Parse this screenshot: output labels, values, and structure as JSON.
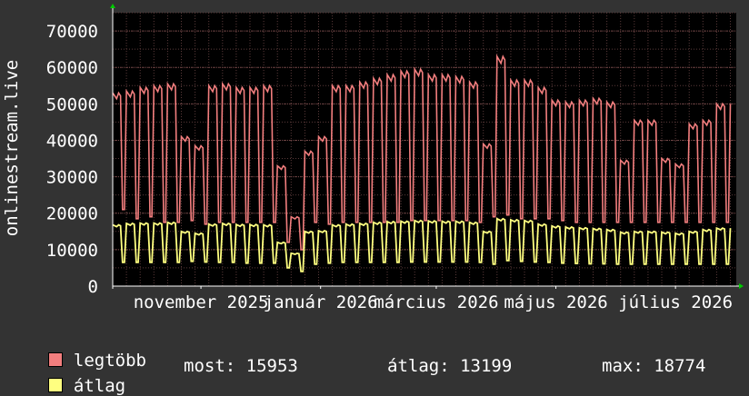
{
  "chart_data": {
    "type": "line",
    "ylabel": "onlinestream.live",
    "ylim": [
      0,
      75000
    ],
    "yticks": [
      0,
      10000,
      20000,
      30000,
      40000,
      50000,
      60000,
      70000
    ],
    "ytick_labels": [
      "0",
      "10000",
      "20000",
      "30000",
      "40000",
      "50000",
      "60000",
      "70000"
    ],
    "xlim": [
      "2025-10-01",
      "2026-08-15"
    ],
    "xticks": [
      {
        "date": "2025-11-15",
        "label": "november 2025"
      },
      {
        "date": "2026-01-15",
        "label": "január 2026"
      },
      {
        "date": "2026-03-15",
        "label": "március 2026"
      },
      {
        "date": "2026-05-15",
        "label": "május 2026"
      },
      {
        "date": "2026-07-15",
        "label": "július 2026"
      }
    ],
    "grid": true,
    "series": [
      {
        "name": "legtöbb",
        "color": "#f27e7e",
        "weekly": [
          [
            "2025-10-01",
            53000,
            21000
          ],
          [
            "2025-10-08",
            53500,
            18500
          ],
          [
            "2025-10-15",
            54500,
            19000
          ],
          [
            "2025-10-22",
            55000,
            17500
          ],
          [
            "2025-10-29",
            55500,
            17500
          ],
          [
            "2025-11-05",
            41000,
            18000
          ],
          [
            "2025-11-12",
            38500,
            17000
          ],
          [
            "2025-11-19",
            55000,
            17500
          ],
          [
            "2025-11-26",
            55500,
            17500
          ],
          [
            "2025-12-03",
            54500,
            17500
          ],
          [
            "2025-12-10",
            54500,
            17500
          ],
          [
            "2025-12-17",
            55000,
            17500
          ],
          [
            "2025-12-24",
            33000,
            12000
          ],
          [
            "2025-12-31",
            19000,
            10000
          ],
          [
            "2026-01-07",
            37000,
            17500
          ],
          [
            "2026-01-14",
            41000,
            17000
          ],
          [
            "2026-01-21",
            55000,
            17500
          ],
          [
            "2026-01-28",
            55000,
            17500
          ],
          [
            "2026-02-04",
            56000,
            17500
          ],
          [
            "2026-02-11",
            57000,
            17500
          ],
          [
            "2026-02-18",
            58000,
            17500
          ],
          [
            "2026-02-25",
            59000,
            18000
          ],
          [
            "2026-03-04",
            59500,
            18000
          ],
          [
            "2026-03-11",
            58000,
            18000
          ],
          [
            "2026-03-18",
            58000,
            18000
          ],
          [
            "2026-03-25",
            57500,
            18000
          ],
          [
            "2026-04-01",
            56000,
            17500
          ],
          [
            "2026-04-08",
            39000,
            19000
          ],
          [
            "2026-04-15",
            63000,
            19500
          ],
          [
            "2026-04-22",
            56500,
            18500
          ],
          [
            "2026-04-29",
            56500,
            18500
          ],
          [
            "2026-05-06",
            54500,
            18500
          ],
          [
            "2026-05-13",
            51000,
            18000
          ],
          [
            "2026-05-20",
            50500,
            17500
          ],
          [
            "2026-05-27",
            51000,
            17500
          ],
          [
            "2026-06-03",
            51500,
            17500
          ],
          [
            "2026-06-10",
            50500,
            17500
          ],
          [
            "2026-06-17",
            34500,
            17500
          ],
          [
            "2026-06-24",
            45500,
            17500
          ],
          [
            "2026-07-01",
            45500,
            17500
          ],
          [
            "2026-07-08",
            35000,
            17500
          ],
          [
            "2026-07-15",
            33500,
            17500
          ],
          [
            "2026-07-22",
            44500,
            17500
          ],
          [
            "2026-07-29",
            45500,
            17500
          ],
          [
            "2026-08-05",
            50000,
            17500
          ]
        ]
      },
      {
        "name": "átlag",
        "color": "#ffff80",
        "weekly": [
          [
            "2025-10-01",
            16800,
            6500
          ],
          [
            "2025-10-08",
            17200,
            6500
          ],
          [
            "2025-10-15",
            17300,
            6500
          ],
          [
            "2025-10-22",
            17300,
            6500
          ],
          [
            "2025-10-29",
            17500,
            6500
          ],
          [
            "2025-11-05",
            15000,
            6800
          ],
          [
            "2025-11-12",
            14500,
            6600
          ],
          [
            "2025-11-19",
            17000,
            6500
          ],
          [
            "2025-11-26",
            17200,
            6500
          ],
          [
            "2025-12-03",
            16900,
            6300
          ],
          [
            "2025-12-10",
            16900,
            6300
          ],
          [
            "2025-12-17",
            16800,
            6300
          ],
          [
            "2025-12-24",
            12000,
            5000
          ],
          [
            "2025-12-31",
            9000,
            4000
          ],
          [
            "2026-01-07",
            15000,
            6000
          ],
          [
            "2026-01-14",
            15200,
            6300
          ],
          [
            "2026-01-21",
            16800,
            6500
          ],
          [
            "2026-01-28",
            17000,
            6500
          ],
          [
            "2026-02-04",
            17200,
            6500
          ],
          [
            "2026-02-11",
            17500,
            6500
          ],
          [
            "2026-02-18",
            17700,
            6500
          ],
          [
            "2026-02-25",
            17800,
            6600
          ],
          [
            "2026-03-04",
            18000,
            6600
          ],
          [
            "2026-03-11",
            17900,
            6600
          ],
          [
            "2026-03-18",
            17800,
            6600
          ],
          [
            "2026-03-25",
            17800,
            6600
          ],
          [
            "2026-04-01",
            17500,
            6500
          ],
          [
            "2026-04-08",
            15000,
            6000
          ],
          [
            "2026-04-15",
            18500,
            7000
          ],
          [
            "2026-04-22",
            18200,
            6800
          ],
          [
            "2026-04-29",
            18000,
            6600
          ],
          [
            "2026-05-06",
            17000,
            6500
          ],
          [
            "2026-05-13",
            16500,
            6300
          ],
          [
            "2026-05-20",
            16200,
            6200
          ],
          [
            "2026-05-27",
            16000,
            6100
          ],
          [
            "2026-06-03",
            15800,
            6100
          ],
          [
            "2026-06-10",
            15500,
            6000
          ],
          [
            "2026-06-17",
            14800,
            6000
          ],
          [
            "2026-06-24",
            15000,
            6000
          ],
          [
            "2026-07-01",
            15000,
            6000
          ],
          [
            "2026-07-08",
            14800,
            6000
          ],
          [
            "2026-07-15",
            14500,
            6000
          ],
          [
            "2026-07-22",
            15000,
            6000
          ],
          [
            "2026-07-29",
            15500,
            6000
          ],
          [
            "2026-08-05",
            15900,
            6000
          ]
        ]
      }
    ]
  },
  "legend": {
    "max_label": "legtöbb",
    "avg_label": "átlag",
    "max_color": "#f27e7e",
    "avg_color": "#ffff80"
  },
  "stats": {
    "most": "most: 15953",
    "atlag": "átlag: 13199",
    "max": "max: 18774"
  }
}
